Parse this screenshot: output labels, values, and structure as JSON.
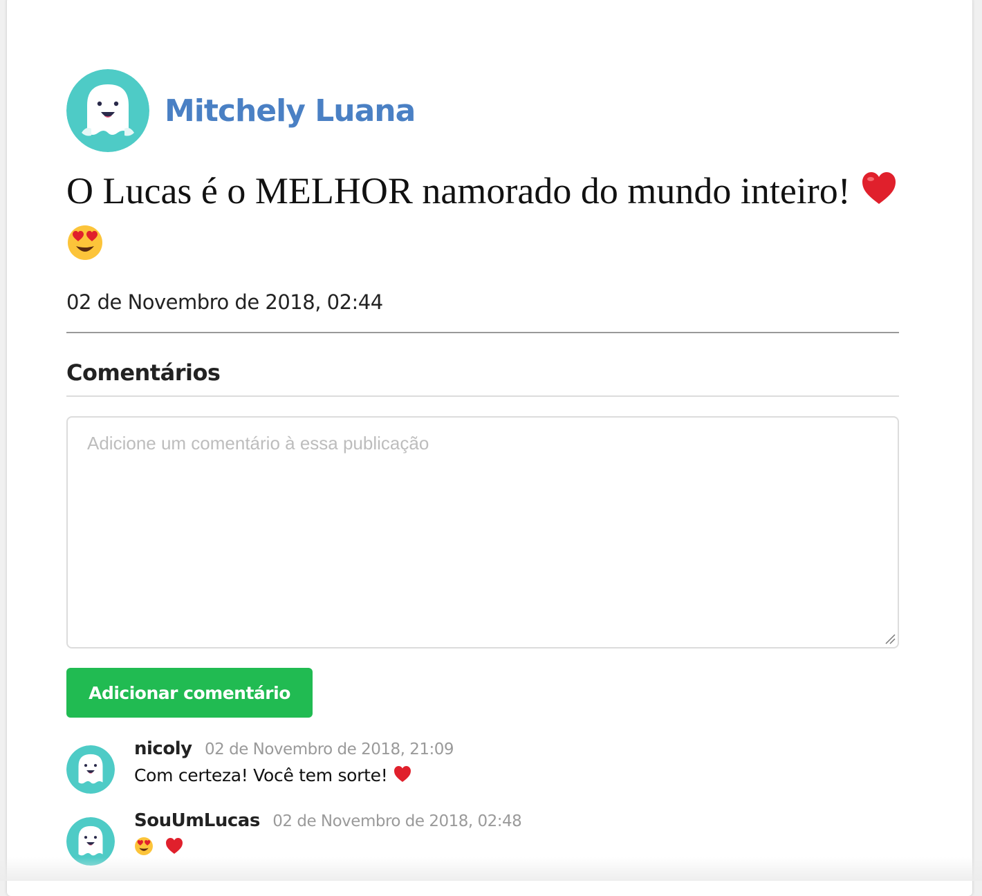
{
  "post": {
    "author": "Mitchely Luana",
    "text": "O Lucas é o MELHOR namorado do mundo inteiro!",
    "emojis": [
      "heart-emoji",
      "heart-eyes-emoji"
    ],
    "date": "02 de Novembro de 2018, 02:44"
  },
  "comments_section": {
    "title": "Comentários",
    "input": {
      "placeholder": "Adicione um comentário à essa publicação",
      "value": ""
    },
    "submit_label": "Adicionar comentário"
  },
  "comments": [
    {
      "user": "nicoly",
      "date": "02 de Novembro de 2018, 21:09",
      "text": "Com certeza! Você tem sorte!",
      "emojis": [
        "heart-emoji"
      ]
    },
    {
      "user": "SouUmLucas",
      "date": "02 de Novembro de 2018, 02:48",
      "text": "",
      "emojis": [
        "heart-eyes-emoji",
        "heart-emoji"
      ]
    }
  ],
  "colors": {
    "accent_name": "#4a80c4",
    "avatar_bg": "#4ecbc6",
    "button_bg": "#21bb52",
    "button_text": "#ffffff",
    "heart": "#e0202c"
  },
  "icons": {
    "avatar": "ghost-avatar-icon",
    "resize": "resize-handle-icon"
  }
}
